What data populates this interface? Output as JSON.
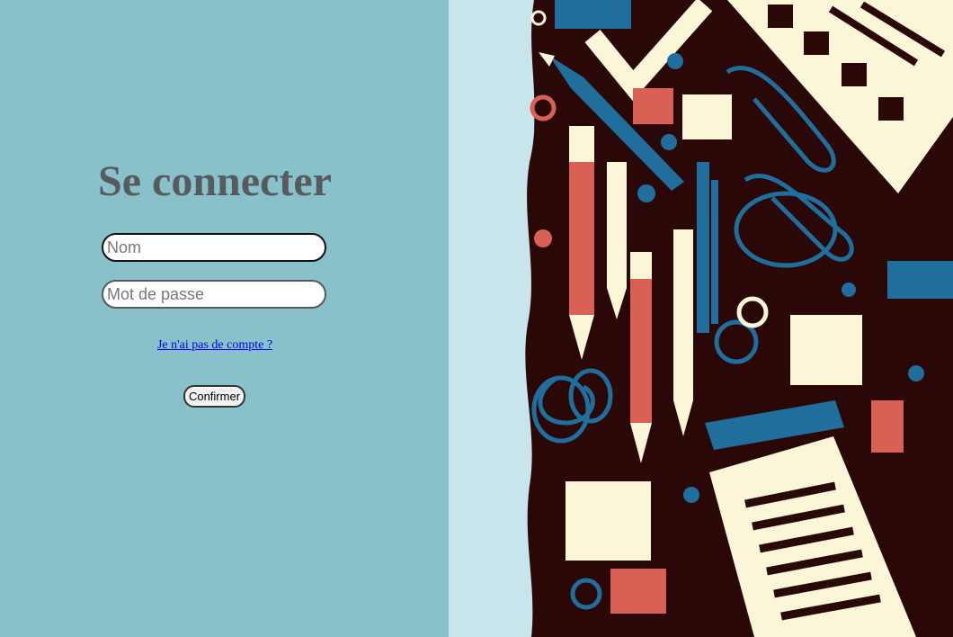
{
  "login": {
    "title": "Se connecter",
    "name_placeholder": "Nom",
    "password_placeholder": "Mot de passe",
    "no_account_link": "Je n'ai pas de compte ?",
    "confirm_label": "Confirmer"
  },
  "colors": {
    "left_panel_bg": "#88c1ca",
    "title_color": "#575b5d",
    "link_color": "#0000ee",
    "illustration_dark": "#2a0808",
    "illustration_cream": "#fbf6d8",
    "illustration_blue": "#1f6e9c",
    "illustration_red": "#d96055"
  },
  "illustration": {
    "icon": "office-supplies-illustration"
  }
}
